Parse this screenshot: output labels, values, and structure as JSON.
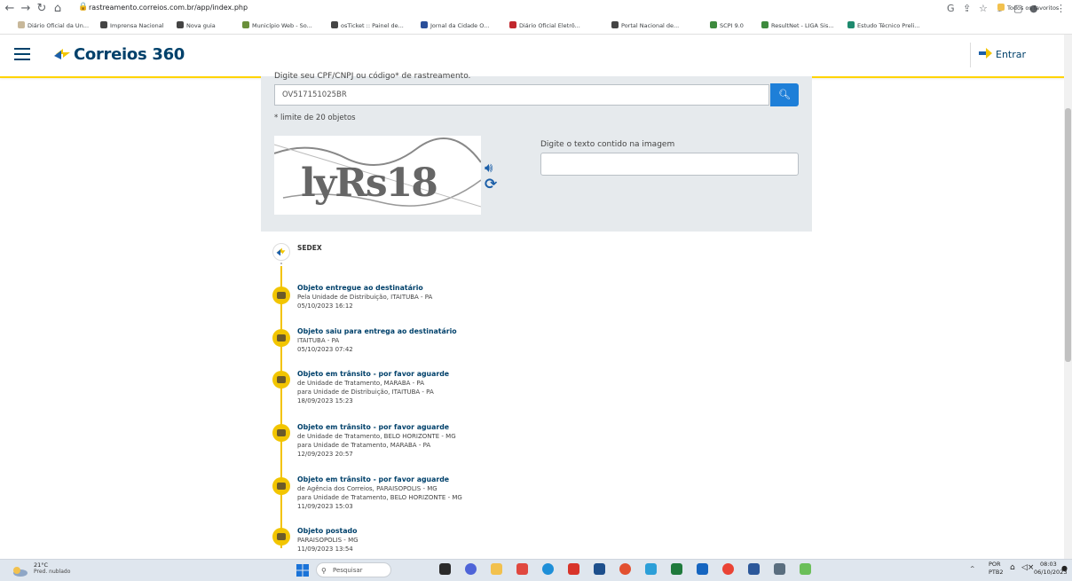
{
  "browser": {
    "url": "rastreamento.correios.com.br/app/index.php",
    "bookmarks": [
      {
        "label": "Diário Oficial da Un...",
        "color": "#c8b89a"
      },
      {
        "label": "Imprensa Nacional",
        "color": "#444444"
      },
      {
        "label": "Nova guia",
        "color": "#444444"
      },
      {
        "label": "Município Web - So...",
        "color": "#6a8f3a"
      },
      {
        "label": "osTicket :: Painel de...",
        "color": "#444444"
      },
      {
        "label": "Jornal da Cidade O...",
        "color": "#2a4f9a"
      },
      {
        "label": "Diário Oficial Eletrô...",
        "color": "#c1272d"
      },
      {
        "label": "Portal Nacional de...",
        "color": "#444444"
      },
      {
        "label": "SCPI 9.0",
        "color": "#3d8a3d"
      },
      {
        "label": "ResultNet - LIGA Sis...",
        "color": "#3d8a3d"
      },
      {
        "label": "Estudo Técnico Preli...",
        "color": "#1e8a6e"
      }
    ],
    "all_favorites": "Todos os favoritos"
  },
  "header": {
    "logo": "Correios 360",
    "login": "Entrar"
  },
  "search": {
    "label": "Digite seu CPF/CNPJ ou código* de rastreamento.",
    "value": "OV517151025BR",
    "limit_note": "* limite de 20 objetos",
    "captcha_label": "Digite o texto contido na imagem",
    "captcha_text": "lyRs18"
  },
  "tracking": {
    "service": "SEDEX",
    "events": [
      {
        "title": "Objeto entregue ao destinatário",
        "lines": [
          "Pela Unidade de Distribuição, ITAITUBA - PA",
          "05/10/2023 16:12"
        ]
      },
      {
        "title": "Objeto saiu para entrega ao destinatário",
        "lines": [
          "ITAITUBA - PA",
          "05/10/2023 07:42"
        ]
      },
      {
        "title": "Objeto em trânsito - por favor aguarde",
        "lines": [
          "de Unidade de Tratamento, MARABA - PA",
          "para Unidade de Distribuição, ITAITUBA - PA",
          "18/09/2023 15:23"
        ]
      },
      {
        "title": "Objeto em trânsito - por favor aguarde",
        "lines": [
          "de Unidade de Tratamento, BELO HORIZONTE - MG",
          "para Unidade de Tratamento, MARABA - PA",
          "12/09/2023 20:57"
        ]
      },
      {
        "title": "Objeto em trânsito - por favor aguarde",
        "lines": [
          "de Agência dos Correios, PARAISOPOLIS - MG",
          "para Unidade de Tratamento, BELO HORIZONTE - MG",
          "11/09/2023 15:03"
        ]
      },
      {
        "title": "Objeto postado",
        "lines": [
          "PARAISOPOLIS - MG",
          "11/09/2023 13:54"
        ]
      }
    ]
  },
  "taskbar": {
    "weather_temp": "21°C",
    "weather_desc": "Pred. nublado",
    "search_placeholder": "Pesquisar",
    "lang": "POR",
    "layout": "PTB2",
    "time": "08:03",
    "date": "06/10/2023"
  },
  "colors": {
    "brand_blue": "#00416b",
    "brand_yellow": "#ffd400",
    "search_button": "#1e7fd8"
  }
}
